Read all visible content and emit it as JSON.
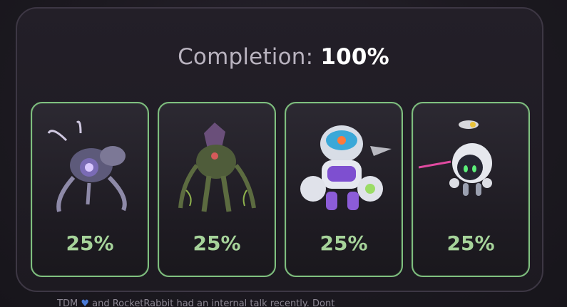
{
  "completion": {
    "label": "Completion:",
    "value": "100%"
  },
  "cards": [
    {
      "value": "25%",
      "icon": "spider-bot-icon"
    },
    {
      "value": "25%",
      "icon": "thorn-creature-icon"
    },
    {
      "value": "25%",
      "icon": "astronaut-mech-icon"
    },
    {
      "value": "25%",
      "icon": "drone-bot-icon"
    }
  ],
  "footer": {
    "text_before": "TDM",
    "text_after": "and RocketRabbit had an internal talk recently. Dont"
  },
  "colors": {
    "card_border": "#7fbf7f",
    "card_value": "#a6d39a",
    "title_label": "#b9b3bf",
    "title_value": "#ffffff"
  }
}
